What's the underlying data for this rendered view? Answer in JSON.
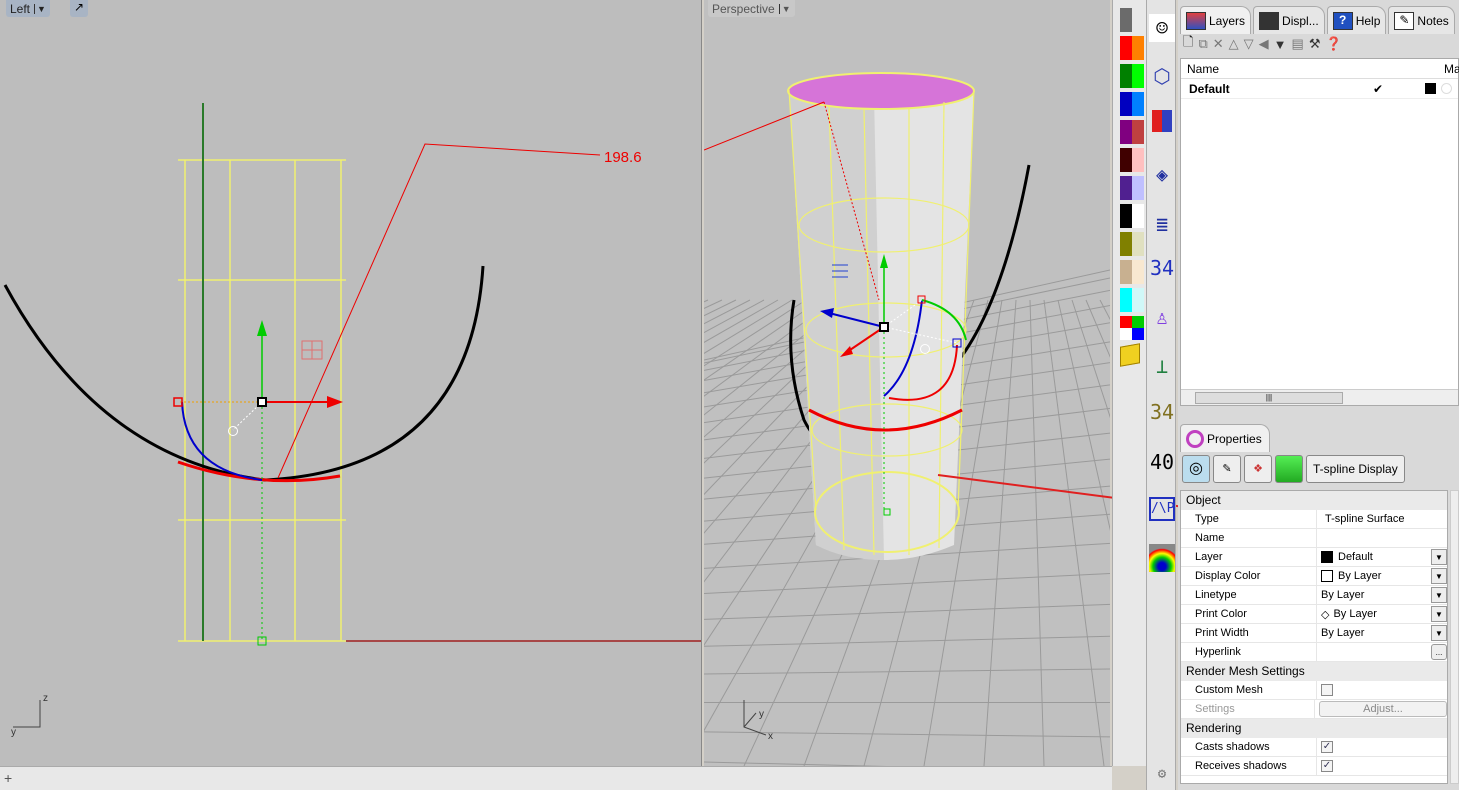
{
  "viewports": {
    "left": {
      "title": "Left",
      "dimension": "198.6",
      "axis_z": "z",
      "axis_y": "y"
    },
    "perspective": {
      "title": "Perspective",
      "axis_y": "y",
      "axis_x": "x"
    }
  },
  "swatch_colors": [
    [
      "#6b6b6b",
      "#e8e8e8"
    ],
    [
      "#ff0000",
      "#ff8000"
    ],
    [
      "#008000",
      "#00ff00"
    ],
    [
      "#0000c0",
      "#0080ff"
    ],
    [
      "#800080",
      "#c04040"
    ],
    [
      "#400000",
      "#ffc0c0"
    ],
    [
      "#502090",
      "#c0c0ff"
    ],
    [
      "#000000",
      "#ffffff"
    ],
    [
      "#808000",
      "#e0e0c0"
    ],
    [
      "#c8b090",
      "#f8e8d0"
    ],
    [
      "#00ffff",
      "#d0f8f8"
    ]
  ],
  "side_tabs": [
    "smiley-icon",
    "mesh-icon",
    "color-bars-icon",
    "layer-3-icon",
    "stack-icon",
    "34",
    "figure-icon",
    "gumball-icon",
    "34",
    "40",
    "AP",
    "rainbow-icon"
  ],
  "side_tab_text": {
    "t34a": "34",
    "t34b": "34",
    "t40": "40",
    "tap": "/\\P"
  },
  "panel": {
    "tabs": [
      {
        "label": "Layers",
        "icon": "layers-icon"
      },
      {
        "label": "Displ...",
        "icon": "display-icon"
      },
      {
        "label": "Help",
        "icon": "help-icon"
      },
      {
        "label": "Notes",
        "icon": "notes-icon"
      }
    ],
    "layers": {
      "columns": {
        "name": "Name",
        "material": "Ma"
      },
      "rows": [
        {
          "name": "Default",
          "current": "✔",
          "color": "#000000"
        }
      ]
    },
    "properties": {
      "tab_label": "Properties",
      "tspline_button": "T-spline Display",
      "sections": {
        "object": "Object",
        "render_mesh": "Render Mesh Settings",
        "rendering": "Rendering"
      },
      "rows": {
        "type": {
          "label": "Type",
          "value": "T-spline Surface"
        },
        "name": {
          "label": "Name",
          "value": ""
        },
        "layer": {
          "label": "Layer",
          "value": "Default"
        },
        "display_color": {
          "label": "Display Color",
          "value": "By Layer"
        },
        "linetype": {
          "label": "Linetype",
          "value": "By Layer"
        },
        "print_color": {
          "label": "Print Color",
          "value": "By Layer"
        },
        "print_width": {
          "label": "Print Width",
          "value": "By Layer"
        },
        "hyperlink": {
          "label": "Hyperlink",
          "button": "..."
        },
        "custom_mesh": {
          "label": "Custom Mesh",
          "checked": false
        },
        "settings": {
          "label": "Settings",
          "button": "Adjust..."
        },
        "casts_shadows": {
          "label": "Casts shadows",
          "checked": true,
          "mark": "✓"
        },
        "receives_shadows": {
          "label": "Receives shadows",
          "checked": true,
          "mark": "✓"
        }
      }
    }
  },
  "status": {
    "add_icon": "+"
  }
}
